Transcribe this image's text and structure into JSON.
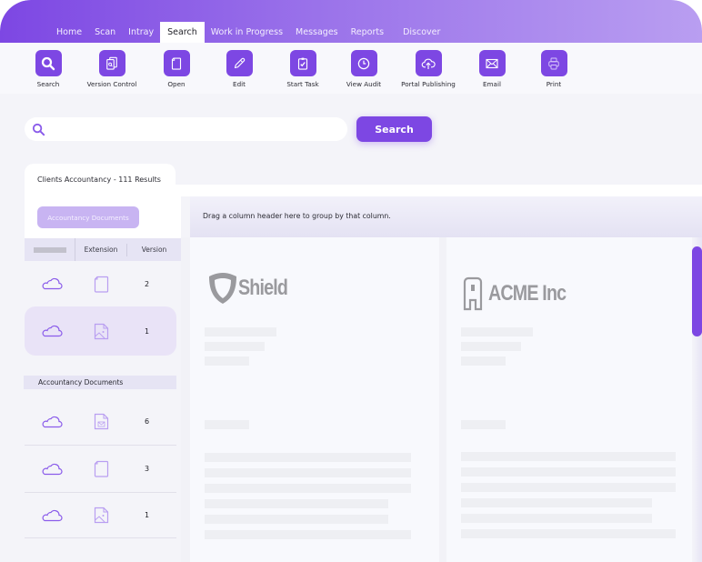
{
  "colors": {
    "accent": "#7d47e3",
    "chip": "#c8b4f2",
    "selected_row": "#e9e3f7"
  },
  "nav": {
    "items": [
      {
        "label": "Home",
        "active": false
      },
      {
        "label": "Scan",
        "active": false
      },
      {
        "label": "Intray",
        "active": false
      },
      {
        "label": "Search",
        "active": true
      },
      {
        "label": "Work in Progress",
        "active": false
      },
      {
        "label": "Messages",
        "active": false
      },
      {
        "label": "Reports",
        "active": false
      },
      {
        "label": "Discover",
        "active": false
      }
    ]
  },
  "toolbar": {
    "items": [
      {
        "label": "Search",
        "icon": "search-icon"
      },
      {
        "label": "Version Control",
        "icon": "version-control-icon"
      },
      {
        "label": "Open",
        "icon": "document-icon"
      },
      {
        "label": "Edit",
        "icon": "pen-icon"
      },
      {
        "label": "Start Task",
        "icon": "task-checklist-icon"
      },
      {
        "label": "View Audit",
        "icon": "clock-icon"
      },
      {
        "label": "Portal Publishing",
        "icon": "cloud-upload-icon"
      },
      {
        "label": "Email",
        "icon": "envelope-icon"
      },
      {
        "label": "Print",
        "icon": "printer-icon"
      }
    ]
  },
  "search": {
    "value": "",
    "placeholder": "",
    "button_label": "Search"
  },
  "results": {
    "tab_label": "Clients Accountancy - 111 Results",
    "group_chip": "Accountancy Documents",
    "groupby_hint": "Drag a column header here to group by that column.",
    "columns": [
      "",
      "Extension",
      "Version"
    ],
    "top_rows": [
      {
        "storage": "cloud-icon",
        "extension": "document-icon",
        "version": "2",
        "selected": false
      },
      {
        "storage": "cloud-icon",
        "extension": "image-file-icon",
        "version": "1",
        "selected": true
      }
    ],
    "group_label": "Accountancy Documents",
    "group_rows": [
      {
        "storage": "cloud-icon",
        "extension": "email-file-icon",
        "version": "6"
      },
      {
        "storage": "cloud-icon",
        "extension": "document-icon",
        "version": "3"
      },
      {
        "storage": "cloud-icon",
        "extension": "image-file-icon",
        "version": "1"
      }
    ]
  },
  "preview": {
    "cards": [
      {
        "logo_text": "Shield",
        "logo_icon": "shield-icon"
      },
      {
        "logo_text": "ACME Inc",
        "logo_icon": "acme-logo-icon"
      }
    ]
  }
}
